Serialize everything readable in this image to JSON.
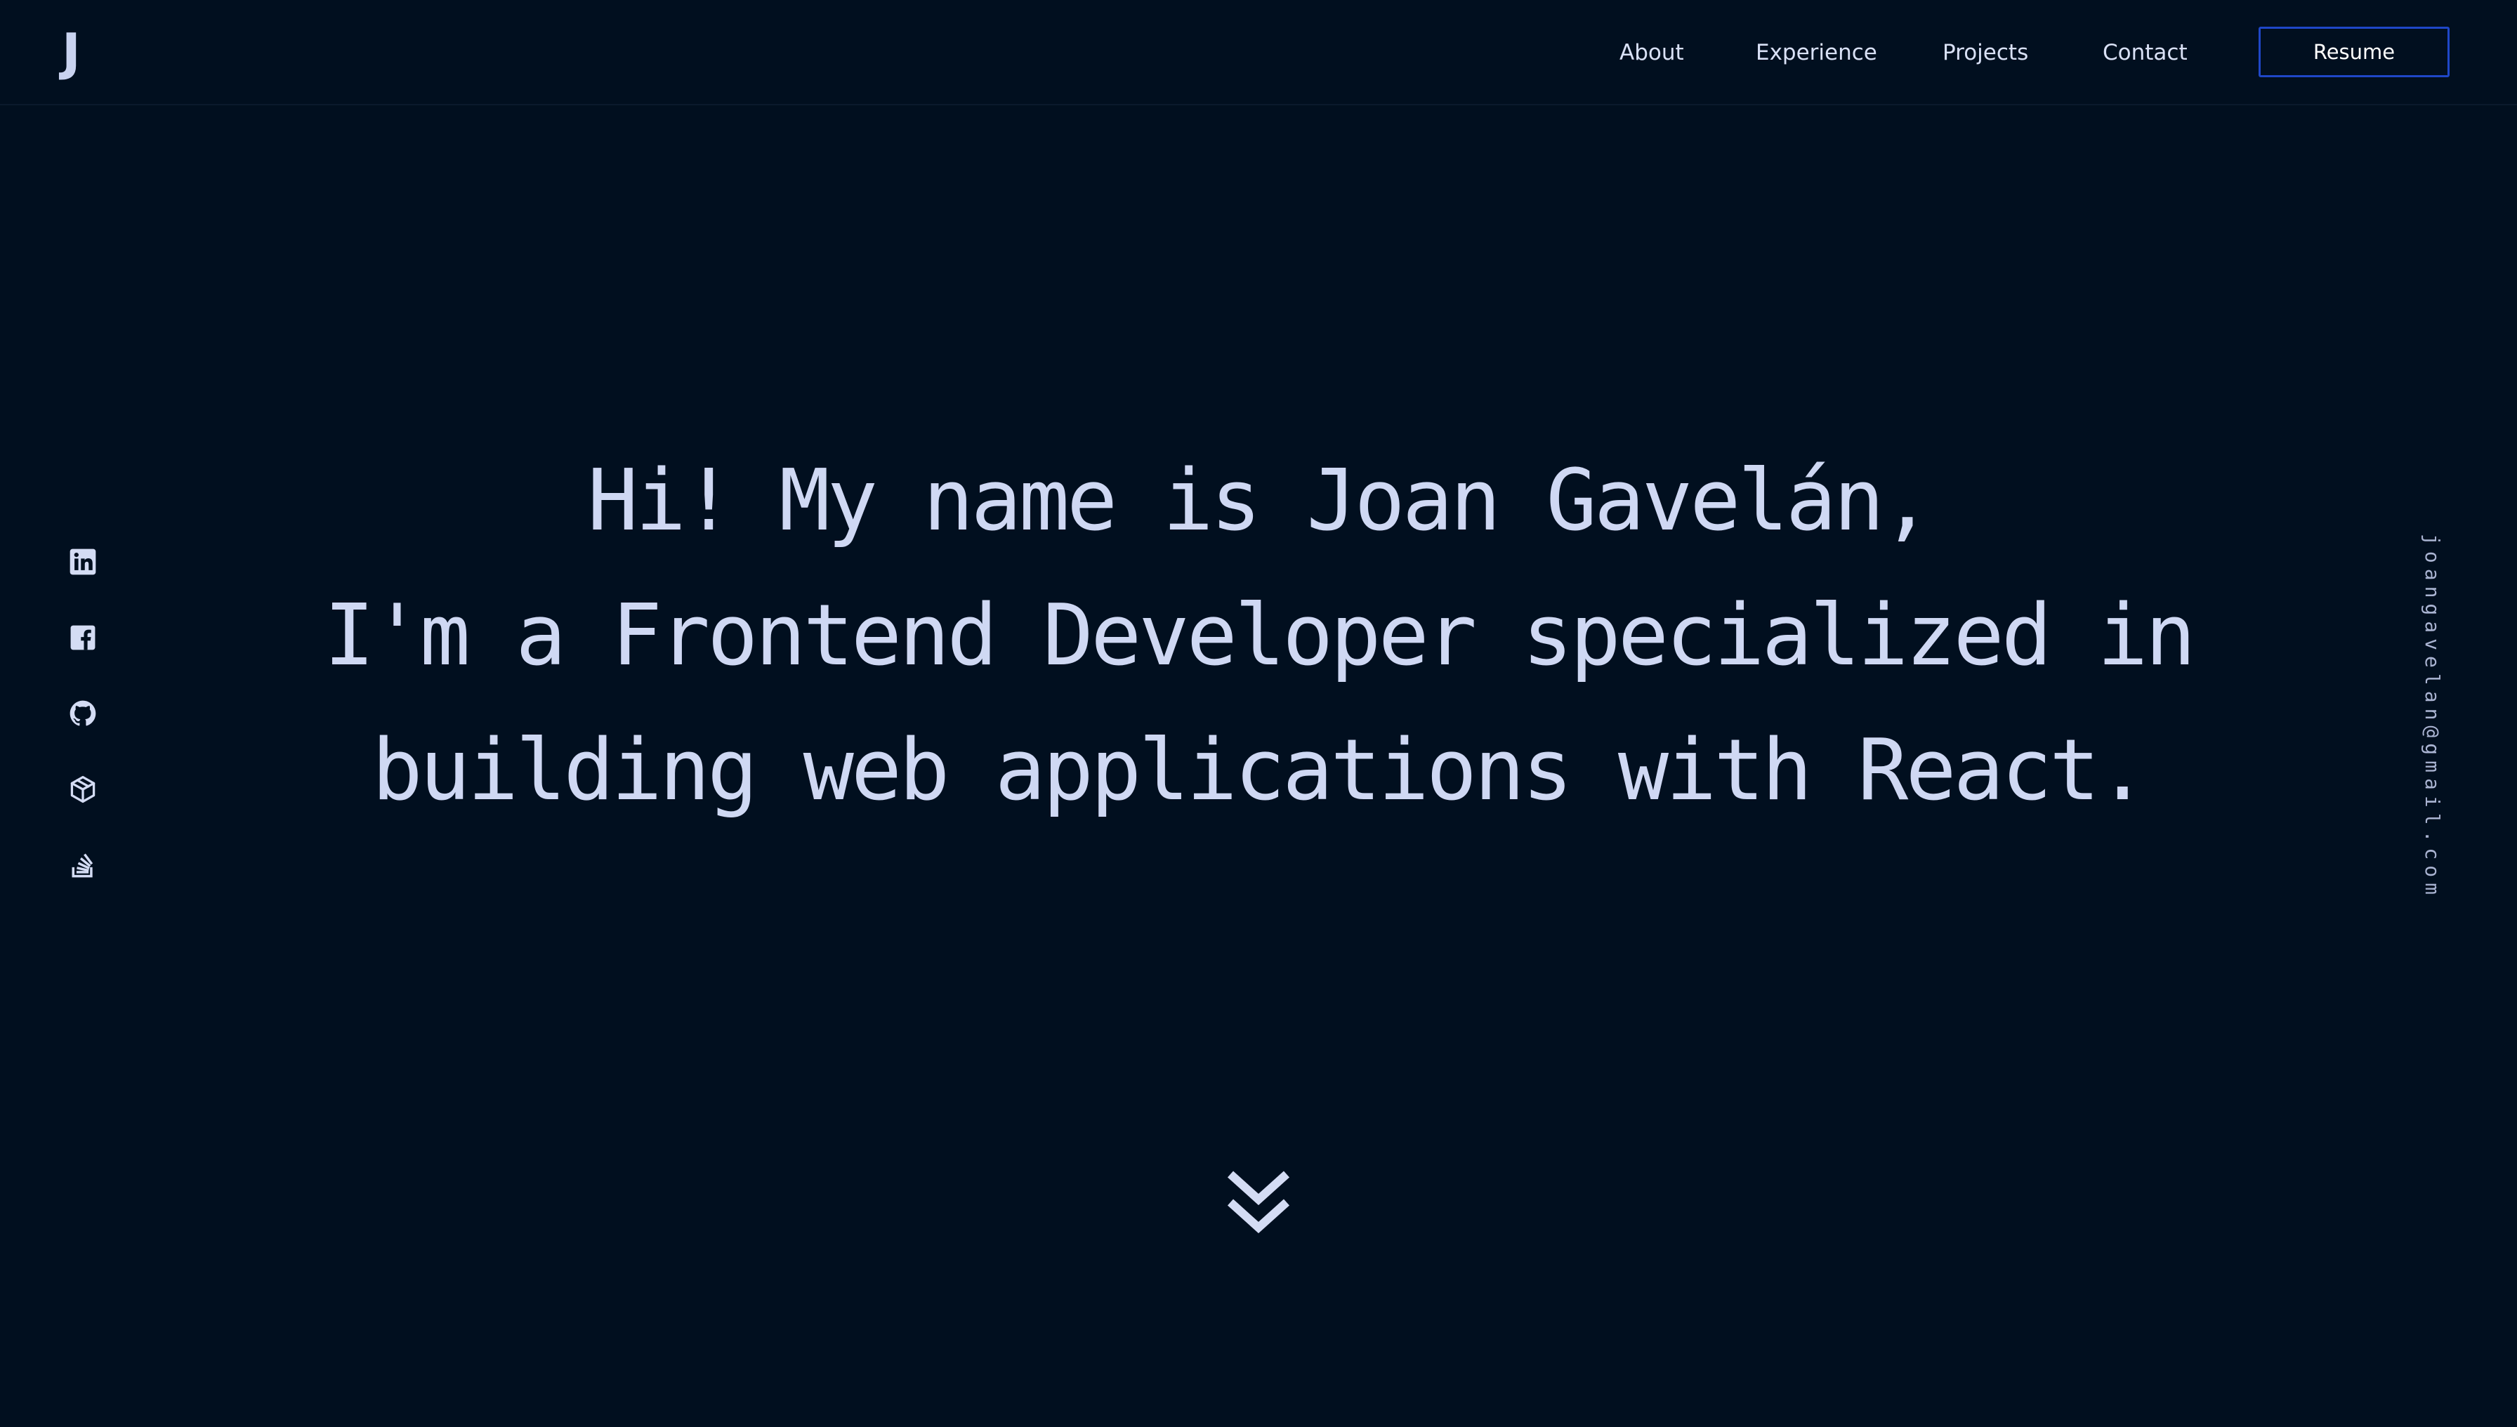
{
  "header": {
    "logo": "J",
    "nav": [
      {
        "label": "About"
      },
      {
        "label": "Experience"
      },
      {
        "label": "Projects"
      },
      {
        "label": "Contact"
      }
    ],
    "resume_label": "Resume"
  },
  "social": [
    {
      "icon": "linkedin-icon"
    },
    {
      "icon": "facebook-icon"
    },
    {
      "icon": "github-icon"
    },
    {
      "icon": "codesandbox-icon"
    },
    {
      "icon": "stackoverflow-icon"
    }
  ],
  "hero": {
    "lines": [
      "Hi! My name is Joan Gavelán,",
      "I'm a Frontend Developer specialized in",
      "building web applications with React."
    ]
  },
  "email": "joangavelan@gmail.com",
  "scroll_icon": "chevrons-down-icon",
  "colors": {
    "background": "#010f1f",
    "text": "#cfd8f3",
    "accent": "#1f47c7"
  }
}
